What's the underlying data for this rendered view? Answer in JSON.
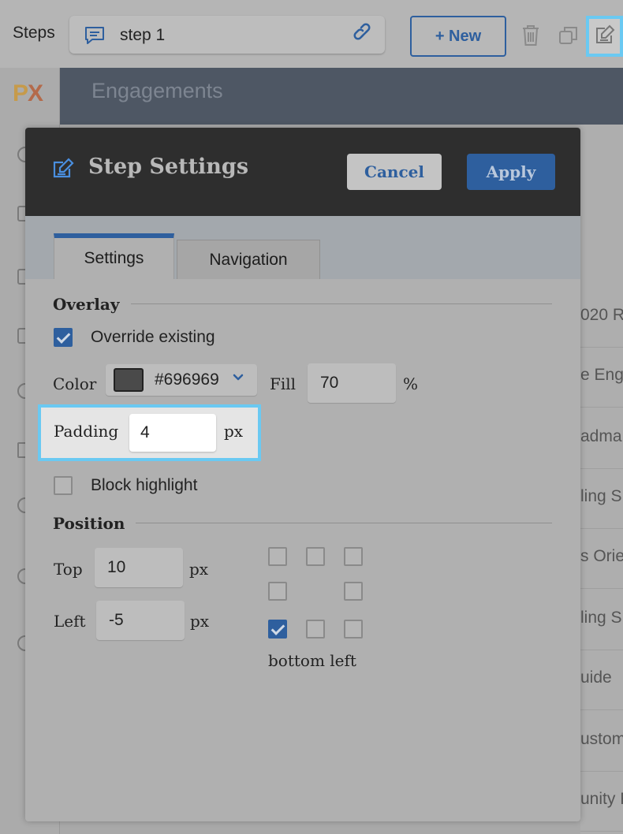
{
  "topbar": {
    "steps_label": "Steps",
    "step_name": "step 1",
    "new_label": "+ New"
  },
  "background": {
    "logo_p": "P",
    "logo_x": "X",
    "header_title": "Engagements",
    "list_items": [
      "020 R",
      "e Enga",
      "adma",
      "ling S",
      "s Orie",
      "ling S",
      "uide",
      "ustom",
      "unity F"
    ]
  },
  "modal": {
    "title": "Step Settings",
    "cancel_label": "Cancel",
    "apply_label": "Apply",
    "tabs": [
      {
        "label": "Settings"
      },
      {
        "label": "Navigation"
      }
    ],
    "overlay": {
      "section_title": "Overlay",
      "override_label": "Override existing",
      "override_checked": true,
      "color_label": "Color",
      "color_value": "#696969",
      "swatch_color": "#4a4a4a",
      "fill_label": "Fill",
      "fill_value": "70",
      "fill_unit": "%",
      "padding_label": "Padding",
      "padding_value": "4",
      "padding_unit": "px",
      "block_highlight_label": "Block highlight",
      "block_highlight_checked": false
    },
    "position": {
      "section_title": "Position",
      "top_label": "Top",
      "top_value": "10",
      "top_unit": "px",
      "left_label": "Left",
      "left_value": "-5",
      "left_unit": "px",
      "anchor_caption": "bottom left",
      "selected_anchor": "bottom-left"
    }
  },
  "colors": {
    "accent": "#2e5f9e",
    "highlight": "#6ac9f2",
    "modal_header": "#2e2e2e"
  }
}
